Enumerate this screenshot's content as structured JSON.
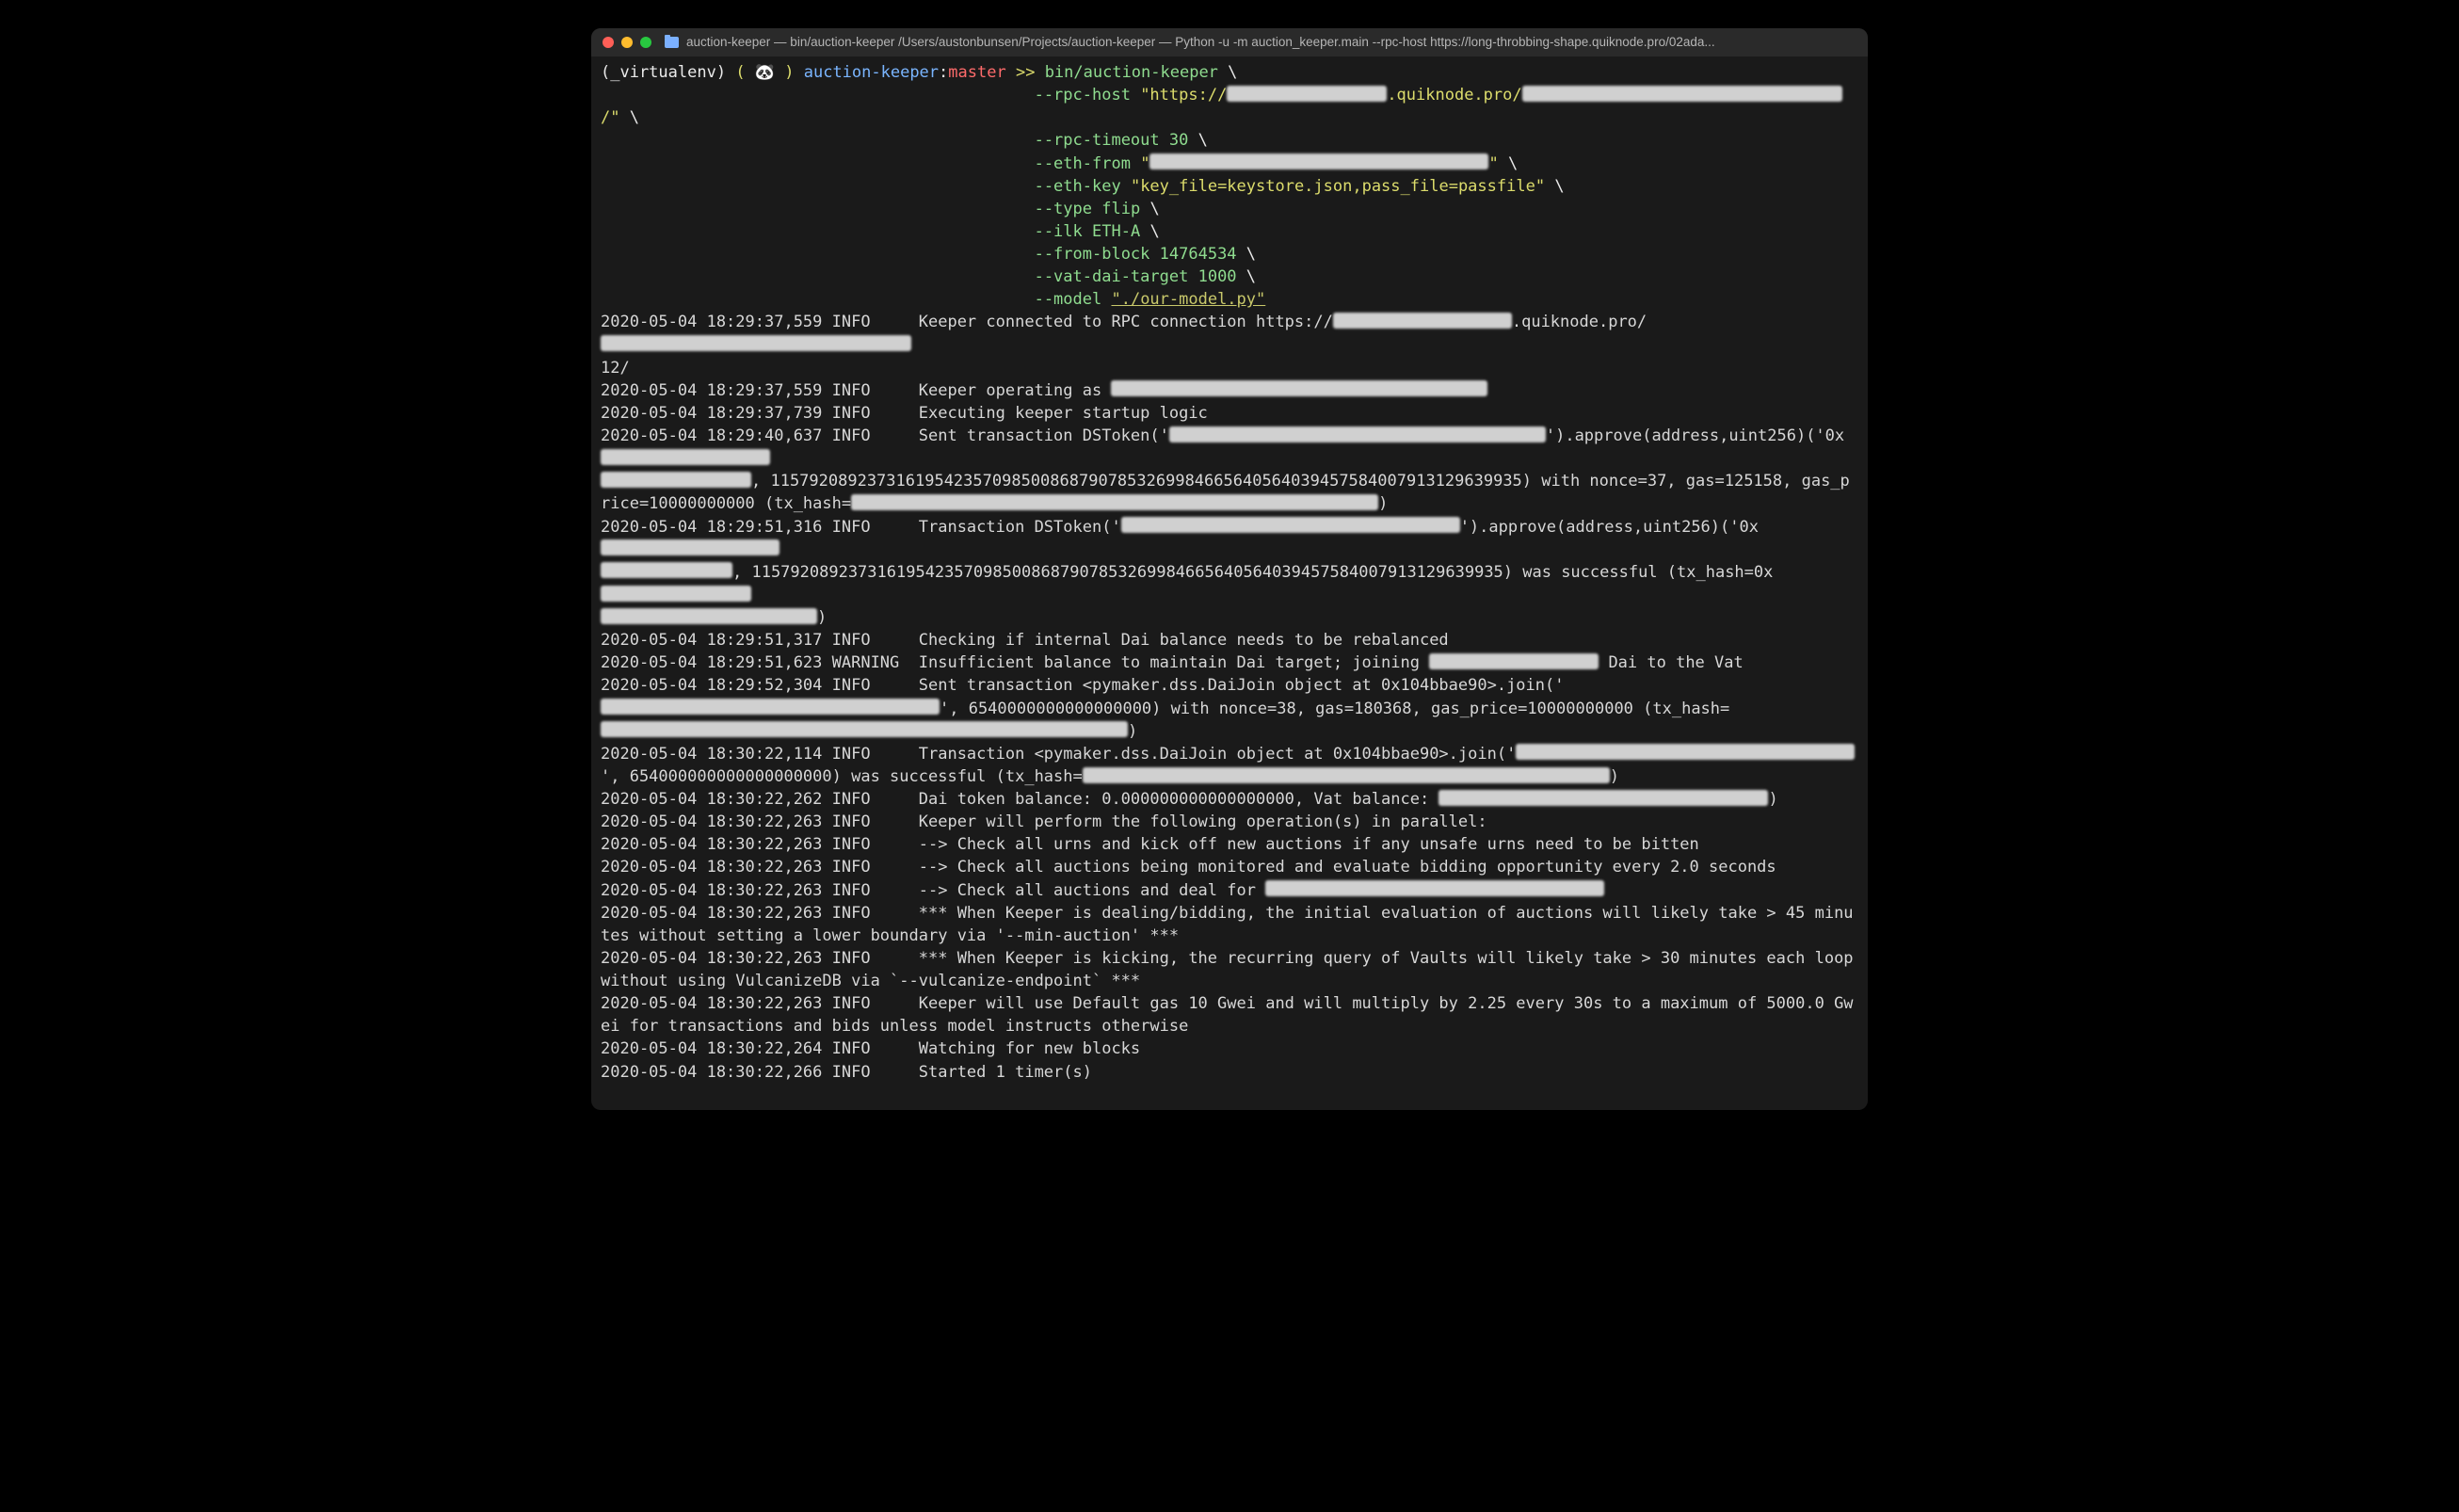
{
  "titlebar": {
    "title": "auction-keeper — bin/auction-keeper /Users/austonbunsen/Projects/auction-keeper — Python -u -m auction_keeper.main --rpc-host https://long-throbbing-shape.quiknode.pro/02ada..."
  },
  "prompt": {
    "venv": "(_virtualenv)",
    "emoji": "🐼",
    "repo": "auction-keeper",
    "branch": "master",
    "arrow": ">>",
    "command": "bin/auction-keeper",
    "backslash": "\\"
  },
  "args": {
    "rpc_host_flag": "--rpc-host",
    "rpc_host_q1": "\"https://",
    "rpc_host_q2": ".quiknode.pro/",
    "rpc_host_q3": "/\"",
    "rpc_timeout_flag": "--rpc-timeout",
    "rpc_timeout_val": "30",
    "eth_from_flag": "--eth-from",
    "eth_from_q1": "\"",
    "eth_from_q2": "\"",
    "eth_key_flag": "--eth-key",
    "eth_key_val": "\"key_file=keystore.json,pass_file=passfile\"",
    "type_flag": "--type",
    "type_val": "flip",
    "ilk_flag": "--ilk",
    "ilk_val": "ETH-A",
    "from_block_flag": "--from-block",
    "from_block_val": "14764534",
    "vat_flag": "--vat-dai-target",
    "vat_val": "1000",
    "model_flag": "--model",
    "model_val": "\"./our-model.py\""
  },
  "log": {
    "l1a": "2020-05-04 18:29:37,559 INFO     Keeper connected to RPC connection https://",
    "l1b": ".quiknode.pro/",
    "l1c": "12/",
    "l2": "2020-05-04 18:29:37,559 INFO     Keeper operating as ",
    "l3": "2020-05-04 18:29:37,739 INFO     Executing keeper startup logic",
    "l4a": "2020-05-04 18:29:40,637 INFO     Sent transaction DSToken('",
    "l4b": "').approve(address,uint256)('0x",
    "l4c": ", 115792089237316195423570985008687907853269984665640564039457584007913129639935) with nonce=37, gas=125158, gas_price=10000000000 (tx_hash=",
    "l4d": ")",
    "l5a": "2020-05-04 18:29:51,316 INFO     Transaction DSToken('",
    "l5b": "').approve(address,uint256)('0x",
    "l5c": ", 115792089237316195423570985008687907853269984665640564039457584007913129639935) was successful (tx_hash=0x",
    "l5d": ")",
    "l6": "2020-05-04 18:29:51,317 INFO     Checking if internal Dai balance needs to be rebalanced",
    "l7a": "2020-05-04 18:29:51,623 WARNING  Insufficient balance to maintain Dai target; joining ",
    "l7b": " Dai to the Vat",
    "l8a": "2020-05-04 18:29:52,304 INFO     Sent transaction <pymaker.dss.DaiJoin object at 0x104bbae90>.join('",
    "l8b": "', 6540000000000000000) with nonce=38, gas=180368, gas_price=10000000000 (tx_hash=",
    "l8c": ")",
    "l9a": "2020-05-04 18:30:22,114 INFO     Transaction <pymaker.dss.DaiJoin object at 0x104bbae90>.join('",
    "l9b": "', 654000000000000000000) was successful (tx_hash=",
    "l9c": ")",
    "l10a": "2020-05-04 18:30:22,262 INFO     Dai token balance: 0.000000000000000000, Vat balance: ",
    "l10b": ")",
    "l11": "2020-05-04 18:30:22,263 INFO     Keeper will perform the following operation(s) in parallel:",
    "l12": "2020-05-04 18:30:22,263 INFO     --> Check all urns and kick off new auctions if any unsafe urns need to be bitten",
    "l13": "2020-05-04 18:30:22,263 INFO     --> Check all auctions being monitored and evaluate bidding opportunity every 2.0 seconds",
    "l14": "2020-05-04 18:30:22,263 INFO     --> Check all auctions and deal for ",
    "l15": "2020-05-04 18:30:22,263 INFO     *** When Keeper is dealing/bidding, the initial evaluation of auctions will likely take > 45 minutes without setting a lower boundary via '--min-auction' ***",
    "l16": "2020-05-04 18:30:22,263 INFO     *** When Keeper is kicking, the recurring query of Vaults will likely take > 30 minutes each loop without using VulcanizeDB via `--vulcanize-endpoint` ***",
    "l17": "2020-05-04 18:30:22,263 INFO     Keeper will use Default gas 10 Gwei and will multiply by 2.25 every 30s to a maximum of 5000.0 Gwei for transactions and bids unless model instructs otherwise",
    "l18": "2020-05-04 18:30:22,264 INFO     Watching for new blocks",
    "l19": "2020-05-04 18:30:22,266 INFO     Started 1 timer(s)"
  }
}
